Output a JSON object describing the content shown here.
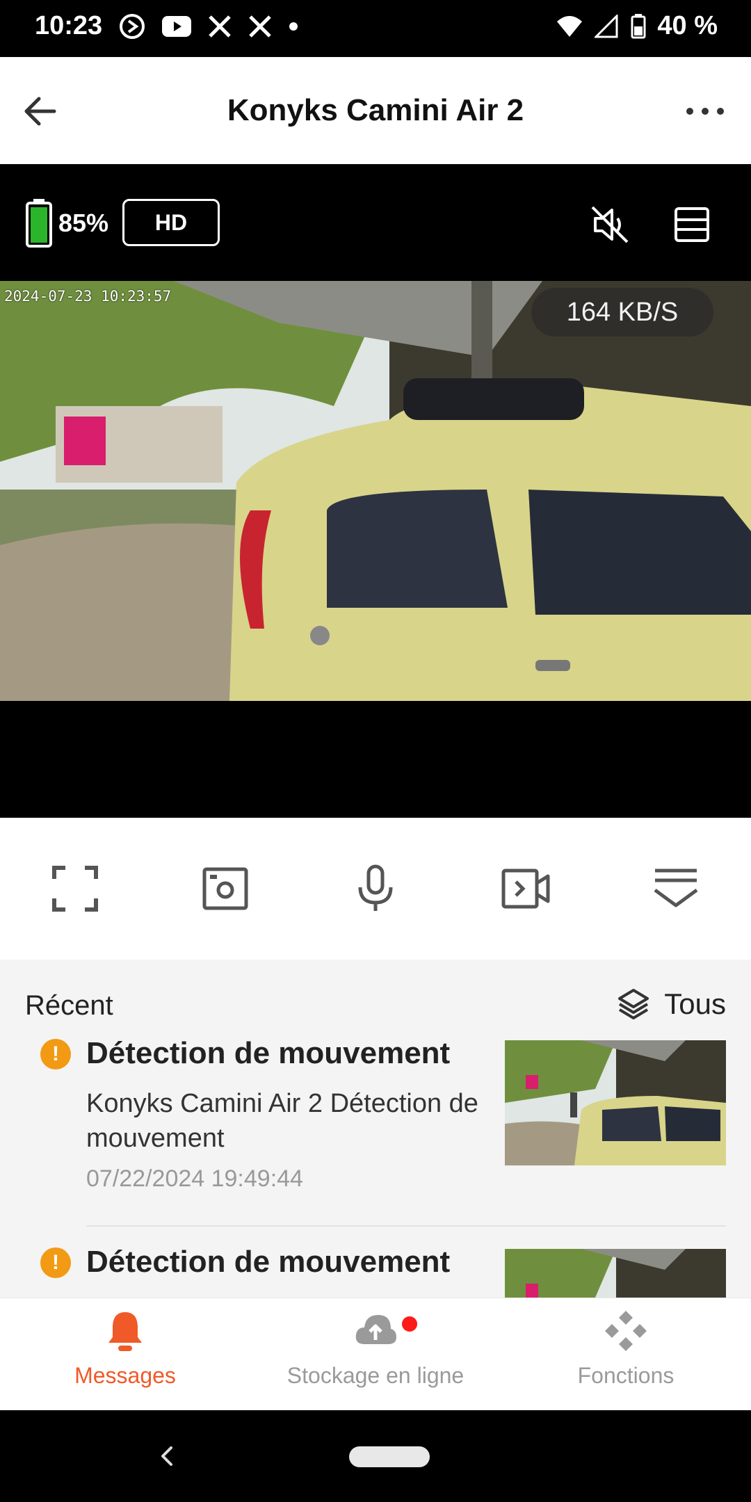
{
  "status_bar": {
    "time": "10:23",
    "battery": "40 %"
  },
  "header": {
    "title": "Konyks Camini Air 2"
  },
  "camera": {
    "battery": "85%",
    "quality": "HD",
    "timestamp": "2024-07-23 10:23:57",
    "bitrate": "164 KB/S"
  },
  "recent": {
    "label": "Récent",
    "filter": "Tous",
    "events": [
      {
        "title": "Détection de mouvement",
        "description": "Konyks Camini Air 2  Détection de mouvement",
        "time": "07/22/2024 19:49:44"
      },
      {
        "title": "Détection de mouvement"
      }
    ]
  },
  "nav": {
    "messages": "Messages",
    "storage": "Stockage en ligne",
    "functions": "Fonctions"
  },
  "colors": {
    "accent": "#f05a28",
    "warning": "#f29a14",
    "battery_green": "#2bb52b",
    "badge_red": "#ff1a1a"
  }
}
